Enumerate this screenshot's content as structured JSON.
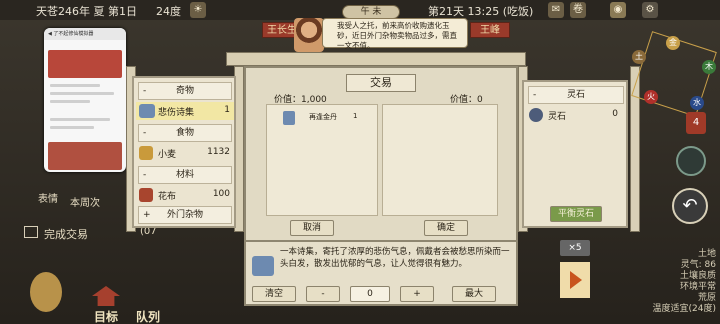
{
  "topbar": {
    "date": "天苍246年 夏 第1日",
    "temp": "24度",
    "day_time": "第21天 13:25 (吃饭)",
    "i1": "✉",
    "i2": "卷",
    "i3": "⚙"
  },
  "header": {
    "time_plate": "午 未",
    "left_name": "王长生",
    "right_name": "王峰",
    "speech": "我受人之托，前来高价收购遗化玉砂，近日外门杂物卖物品过多，需直一文不值。"
  },
  "left_menu": {
    "item1": "表情",
    "item2": "本周次",
    "complete": "完成交易",
    "goal": "目标",
    "team": "队列",
    "zoom": "(07"
  },
  "left_panel": {
    "cat_odd": "奇物",
    "odd_item": "悲伤诗集",
    "odd_qty": "1",
    "cat_food": "食物",
    "food_item": "小麦",
    "food_qty": "1132",
    "cat_mat": "材料",
    "mat_item": "花布",
    "mat_qty": "100",
    "cat_outer": "外门杂物",
    "minus": "-",
    "plus": "+"
  },
  "trade": {
    "title": "交易",
    "left_value": "价值：1,000",
    "right_value": "价值：0",
    "slot_item": "再逢金丹",
    "slot_qty": "1",
    "cancel": "取消",
    "confirm": "确定"
  },
  "right_panel": {
    "cat": "灵石",
    "item": "灵石",
    "qty": "0",
    "balance": "平衡灵石",
    "minus": "-"
  },
  "desc": {
    "text": "一本诗集，寄托了浓厚的悲伤气息，佩戴者会被愁思所染而一头白发，散发出忧郁的气息，让人觉得很有魅力。",
    "clear": "清空",
    "minus": "-",
    "qty": "0",
    "plus": "+",
    "max": "最大"
  },
  "right_status": {
    "land": "土地",
    "qi": "灵气: 86",
    "soil": "土壤良质",
    "env": "环境平常",
    "wild": "荒原",
    "temp": "温度适宜(24度)",
    "x5": "×5",
    "badge": "4"
  },
  "colors": {
    "panel": "#ebe4d0",
    "accent_red": "#9a3a2a",
    "highlight": "#f2e7a4",
    "balance_green": "#7a9a4a"
  }
}
